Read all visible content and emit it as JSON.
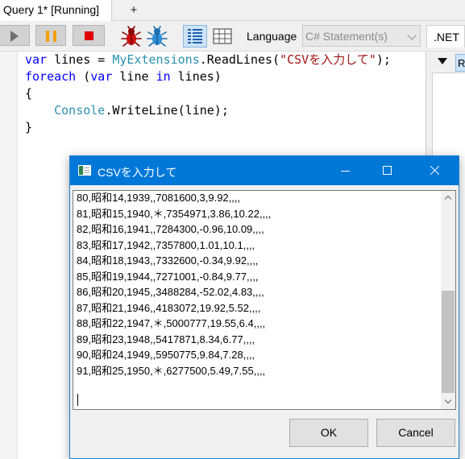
{
  "tab": {
    "active_label": "Query 1* [Running]",
    "add_label": "+"
  },
  "toolbar": {
    "language_label": "Language",
    "language_value": "C# Statement(s)",
    "net_tab": ".NET",
    "icons": [
      "run-icon",
      "pause-icon",
      "stop-icon",
      "bug-icon",
      "bug-off-icon",
      "rich-text-grid-icon",
      "data-grid-icon"
    ]
  },
  "editor": {
    "lines": [
      [
        {
          "t": "var",
          "c": "kw"
        },
        {
          "t": " lines = ",
          "c": ""
        },
        {
          "t": "MyExtensions",
          "c": "ty"
        },
        {
          "t": ".ReadLines(",
          "c": ""
        },
        {
          "t": "\"CSVを入力して\"",
          "c": "st"
        },
        {
          "t": ");",
          "c": ""
        }
      ],
      [
        {
          "t": "foreach",
          "c": "kw"
        },
        {
          "t": " (",
          "c": ""
        },
        {
          "t": "var",
          "c": "kw"
        },
        {
          "t": " line ",
          "c": ""
        },
        {
          "t": "in",
          "c": "kw"
        },
        {
          "t": " lines)",
          "c": ""
        }
      ],
      [
        {
          "t": "{",
          "c": ""
        }
      ],
      [
        {
          "t": "    ",
          "c": ""
        },
        {
          "t": "Console",
          "c": "ty"
        },
        {
          "t": ".WriteLine(line);",
          "c": ""
        }
      ],
      [
        {
          "t": "}",
          "c": ""
        }
      ]
    ]
  },
  "right_panel": {
    "tab_label": "R"
  },
  "dialog": {
    "title": "CSVを入力して",
    "lines": [
      "80,昭和14,1939,,7081600,3,9.92,,,,",
      "81,昭和15,1940,＊,7354971,3.86,10.22,,,,",
      "82,昭和16,1941,,7284300,-0.96,10.09,,,,",
      "83,昭和17,1942,,7357800,1.01,10.1,,,,",
      "84,昭和18,1943,,7332600,-0.34,9.92,,,,",
      "85,昭和19,1944,,7271001,-0.84,9.77,,,,",
      "86,昭和20,1945,,3488284,-52.02,4.83,,,,",
      "87,昭和21,1946,,4183072,19.92,5.52,,,,",
      "88,昭和22,1947,＊,5000777,19.55,6.4,,,,",
      "89,昭和23,1948,,5417871,8.34,6.77,,,,",
      "90,昭和24,1949,,5950775,9.84,7.28,,,,",
      "91,昭和25,1950,＊,6277500,5.49,7.55,,,,"
    ],
    "ok_label": "OK",
    "cancel_label": "Cancel"
  },
  "colors": {
    "titlebar": "#0078d7",
    "keyword": "#0000ff",
    "type": "#2b91af",
    "string": "#a31515",
    "stop": "#e00000",
    "pause": "#f2a000"
  }
}
